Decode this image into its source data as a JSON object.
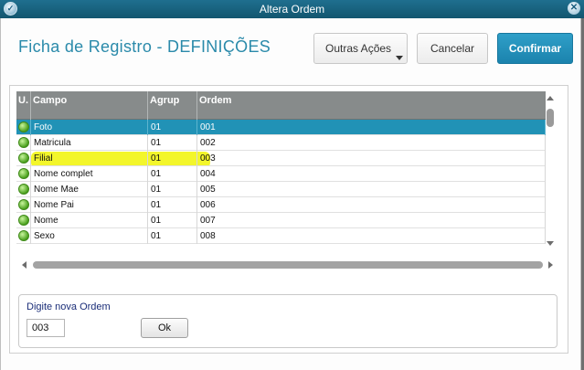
{
  "window": {
    "title": "Altera Ordem",
    "close_glyph": "✕",
    "app_icon_glyph": "✓"
  },
  "header": {
    "title": "Ficha de Registro - DEFINIÇÕES"
  },
  "toolbar": {
    "outras_acoes": "Outras Ações",
    "cancelar": "Cancelar",
    "confirmar": "Confirmar"
  },
  "grid": {
    "columns": [
      "U.",
      "Campo",
      "Agrup",
      "Ordem"
    ],
    "rows": [
      {
        "campo": "Foto",
        "agrup": "01",
        "ordem": "001",
        "status": "green",
        "selected": true
      },
      {
        "campo": "Matricula",
        "agrup": "01",
        "ordem": "002",
        "status": "green"
      },
      {
        "campo": "Filial",
        "agrup": "01",
        "ordem": "003",
        "status": "green",
        "highlighted": true
      },
      {
        "campo": "Nome complet",
        "agrup": "01",
        "ordem": "004",
        "status": "green"
      },
      {
        "campo": "Nome Mae",
        "agrup": "01",
        "ordem": "005",
        "status": "green"
      },
      {
        "campo": "Nome Pai",
        "agrup": "01",
        "ordem": "006",
        "status": "green"
      },
      {
        "campo": "Nome",
        "agrup": "01",
        "ordem": "007",
        "status": "green"
      },
      {
        "campo": "Sexo",
        "agrup": "01",
        "ordem": "008",
        "status": "green"
      }
    ]
  },
  "new_order": {
    "legend": "Digite nova Ordem",
    "value": "003",
    "ok_label": "Ok"
  },
  "colors": {
    "accent": "#2192b6",
    "title": "#2a8aaa",
    "header": "#878b8b",
    "status_green": "#4ba11e",
    "highlight": "#f2f520"
  }
}
